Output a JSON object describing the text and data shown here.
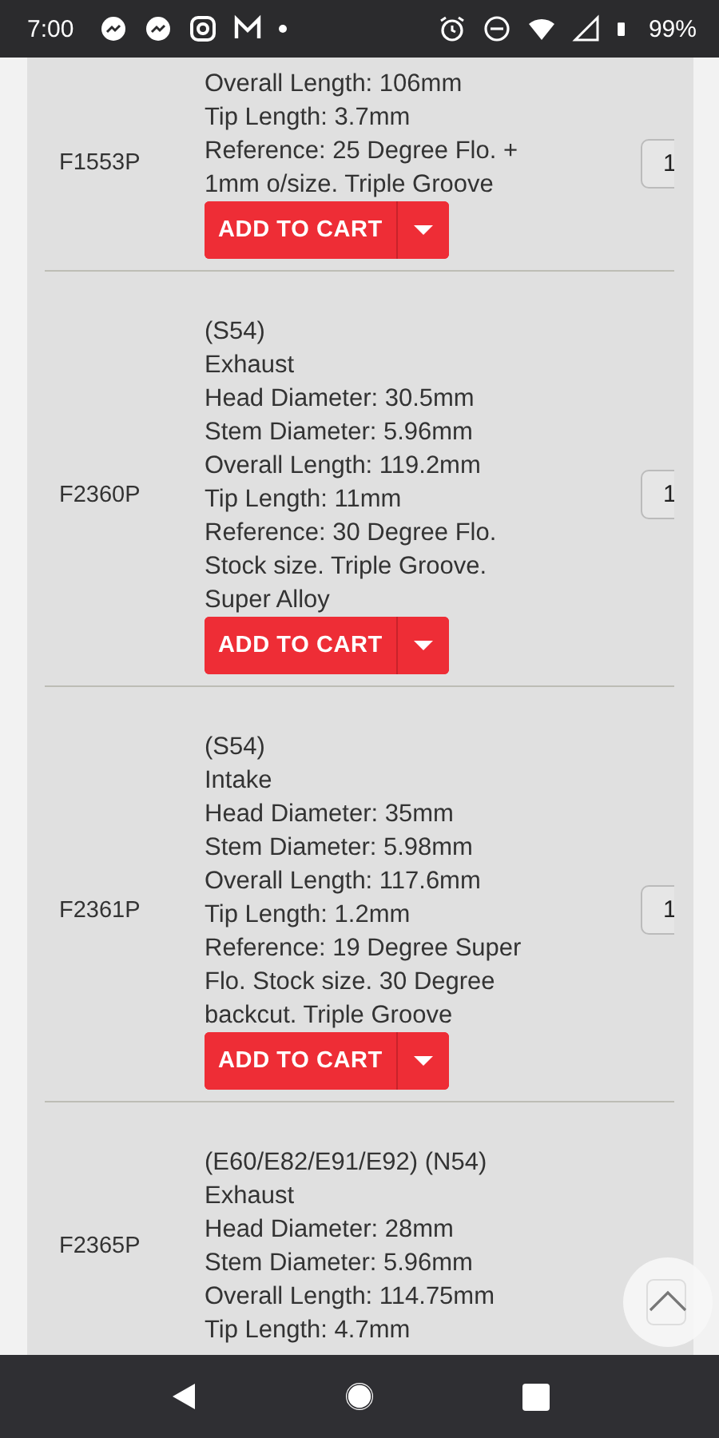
{
  "status_bar": {
    "time": "7:00",
    "battery": "99%"
  },
  "products": [
    {
      "part": "F1553P",
      "lines": [
        "Overall Length: 106mm",
        "Tip Length: 3.7mm",
        "Reference: 25 Degree Flo. + 1mm o/size. Triple Groove"
      ],
      "button": "ADD TO CART",
      "qty": "1"
    },
    {
      "part": "F2360P",
      "lines": [
        "(S54)",
        "Exhaust",
        "Head Diameter: 30.5mm",
        "Stem Diameter: 5.96mm",
        "Overall Length: 119.2mm",
        "Tip Length: 11mm",
        "Reference: 30 Degree Flo. Stock size. Triple Groove. Super Alloy"
      ],
      "button": "ADD TO CART",
      "qty": "1"
    },
    {
      "part": "F2361P",
      "lines": [
        "(S54)",
        "Intake",
        "Head Diameter: 35mm",
        "Stem Diameter: 5.98mm",
        "Overall Length: 117.6mm",
        "Tip Length: 1.2mm",
        "Reference: 19 Degree Super Flo. Stock size. 30 Degree backcut. Triple Groove"
      ],
      "button": "ADD TO CART",
      "qty": "1"
    },
    {
      "part": "F2365P",
      "lines": [
        "(E60/E82/E91/E92) (N54)",
        "Exhaust",
        "Head Diameter: 28mm",
        "Stem Diameter: 5.96mm",
        "Overall Length: 114.75mm",
        "Tip Length: 4.7mm"
      ]
    }
  ]
}
